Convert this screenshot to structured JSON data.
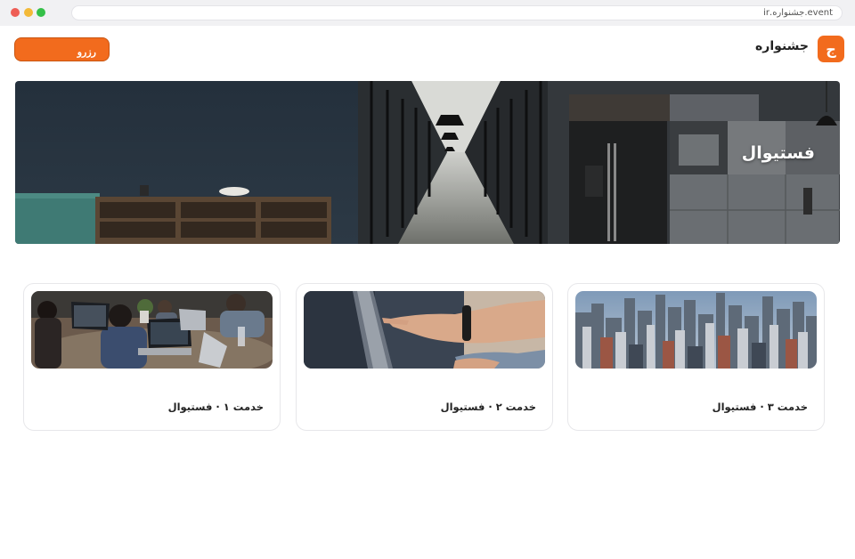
{
  "browser": {
    "url": "event.جشنواره.ir"
  },
  "header": {
    "logo_letter": "ج",
    "brand_name": "جشنواره",
    "reserve_label": "رزرو"
  },
  "hero": {
    "title": "فستیوال"
  },
  "services": [
    {
      "title": "خدمت ۳ · فستیوال"
    },
    {
      "title": "خدمت ۲ · فستیوال"
    },
    {
      "title": "خدمت ۱ · فستیوال"
    }
  ],
  "colors": {
    "accent": "#f26b1d"
  }
}
